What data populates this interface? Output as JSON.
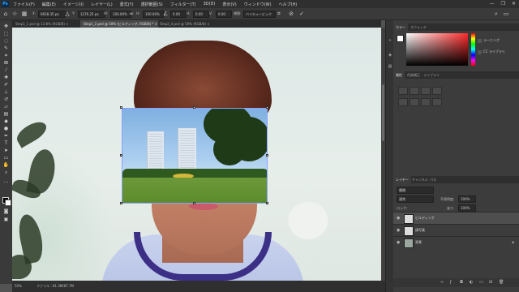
{
  "app": {
    "logo": "Ps",
    "menu": [
      "ファイル(F)",
      "編集(E)",
      "イメージ(I)",
      "レイヤー(L)",
      "書式(Y)",
      "選択範囲(S)",
      "フィルター(T)",
      "3D(D)",
      "表示(V)",
      "ウィンドウ(W)",
      "ヘルプ(H)"
    ],
    "window_controls": [
      "—",
      "❐",
      "✕"
    ]
  },
  "options": {
    "x_label": "X:",
    "x_value": "6658.35 px",
    "y_label": "Y:",
    "y_value": "1276.25 px",
    "w_label": "W:",
    "w_value": "100.00%",
    "h_label": "H:",
    "h_value": "100.00%",
    "angle_value": "0.00",
    "h_skew_label": "H:",
    "h_skew_value": "0.00",
    "v_skew_label": "V:",
    "v_skew_value": "0.00",
    "interp_label": "補間:",
    "interp_value": "バイキュービック",
    "cancel_icon": "cancel-icon",
    "commit_icon": "check-icon"
  },
  "tabs": [
    {
      "label": "Step1_1.psd @ 13.8% (RGB/8) ×",
      "active": false
    },
    {
      "label": "Step1_2.psd @ 50% (ビルディング, RGB/8) * ×",
      "active": true
    },
    {
      "label": "Step2_4.psd @ 50% (RGB/8) ×",
      "active": false
    }
  ],
  "tools": [
    "move-icon",
    "marquee-icon",
    "lasso-icon",
    "quick-select-icon",
    "crop-icon",
    "frame-icon",
    "eyedropper-icon",
    "healing-icon",
    "brush-icon",
    "stamp-icon",
    "history-brush-icon",
    "eraser-icon",
    "gradient-icon",
    "blur-icon",
    "dodge-icon",
    "pen-icon",
    "type-icon",
    "path-select-icon",
    "shape-icon",
    "hand-icon",
    "zoom-icon",
    "more-icon"
  ],
  "status": {
    "zoom": "50%",
    "doc": "ファイル : 61.3M/87.7M"
  },
  "color_panel": {
    "tabs": [
      "カラー",
      "スウォッチ"
    ],
    "foreground": "#ffffff"
  },
  "side_items": [
    {
      "label": "ラーニング",
      "icon": "learn-icon"
    },
    {
      "label": "CC ライブラリ",
      "icon": "library-icon"
    }
  ],
  "adjust_panel": {
    "tabs": [
      "属性",
      "色調補正",
      "ライブラリ"
    ]
  },
  "layers_panel": {
    "tabs": [
      "レイヤー",
      "チャンネル",
      "パス"
    ],
    "filter_placeholder": "種類",
    "blend_mode": "通常",
    "opacity_label": "不透明度:",
    "opacity_value": "100%",
    "lock_label": "ロック:",
    "fill_label": "塗り:",
    "fill_value": "100%",
    "layers": [
      {
        "name": "ビルディング",
        "selected": true,
        "locked": false
      },
      {
        "name": "顔写真",
        "selected": false,
        "locked": false
      },
      {
        "name": "背景",
        "selected": false,
        "locked": true
      }
    ]
  }
}
